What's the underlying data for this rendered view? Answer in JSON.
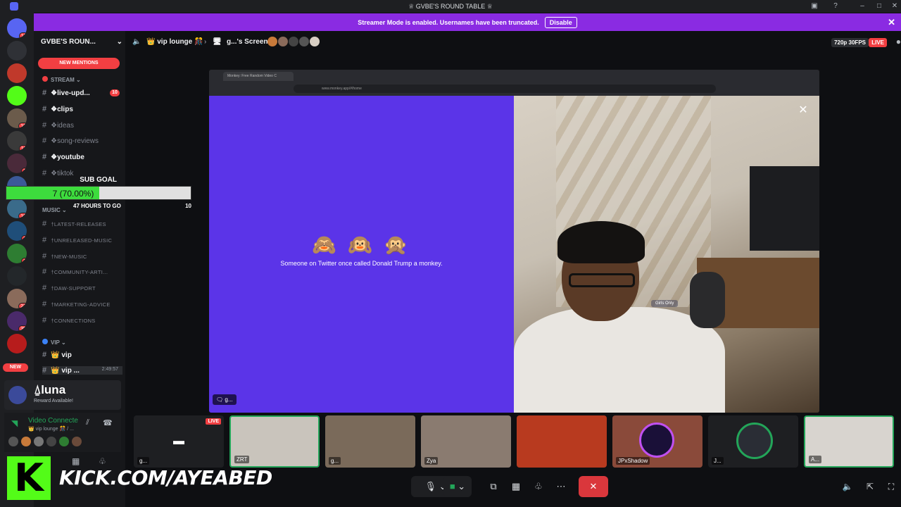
{
  "window": {
    "title": "♕ GVBE'S ROUND TABLE ♕",
    "minimize": "–",
    "maximize": "□",
    "close": "✕"
  },
  "streamer_banner": {
    "message": "Streamer Mode is enabled. Usernames have been truncated.",
    "button": "Disable",
    "close": "✕"
  },
  "server_rail": {
    "items": [
      {
        "icon": "discord-home-icon",
        "badge": "11",
        "color": "#5865f2"
      },
      {
        "icon": "server-icon",
        "badge": "",
        "color": "#2f3136"
      },
      {
        "icon": "server-icon",
        "badge": "",
        "color": "#c0392b"
      },
      {
        "icon": "kick-server-icon",
        "badge": "",
        "color": "#53fc18"
      },
      {
        "icon": "server-icon",
        "badge": "10",
        "color": "#6b5b4b"
      },
      {
        "icon": "server-icon",
        "badge": "11",
        "color": "#3a3a3a"
      },
      {
        "icon": "server-icon",
        "badge": "1",
        "color": "#4a2a3a"
      },
      {
        "icon": "server-icon",
        "badge": "",
        "color": "#3b5998"
      },
      {
        "icon": "server-icon",
        "badge": "10",
        "color": "#3a6b8a"
      },
      {
        "icon": "server-icon",
        "badge": "1",
        "color": "#1f4e79"
      },
      {
        "icon": "server-icon",
        "badge": "1",
        "color": "#2e7d32"
      },
      {
        "icon": "server-icon",
        "badge": "",
        "color": "#23272a"
      },
      {
        "icon": "server-icon",
        "badge": "27",
        "color": "#8a6b5b"
      },
      {
        "icon": "server-icon",
        "badge": "35",
        "color": "#4a2a6a"
      },
      {
        "icon": "server-icon",
        "badge": "",
        "color": "#b71c1c"
      }
    ],
    "new_label": "NEW"
  },
  "channels": {
    "server_name": "GVBE'S ROUN...",
    "new_mentions": "NEW MENTIONS",
    "stream_category": "STREAM",
    "stream_items": [
      {
        "name": "❖live-upd...",
        "badge": "10",
        "unread": true
      },
      {
        "name": "❖clips",
        "badge": "",
        "unread": true
      },
      {
        "name": "❖ideas",
        "badge": "",
        "unread": false
      },
      {
        "name": "❖song-reviews",
        "badge": "",
        "unread": false
      },
      {
        "name": "❖youtube",
        "badge": "",
        "unread": true
      },
      {
        "name": "❖tiktok",
        "badge": "",
        "unread": false
      }
    ],
    "music_category": "MUSIC",
    "music_items": [
      "†LATEST-RELEASES",
      "†UNRELEASED-MUSIC",
      "†NEW-MUSIC",
      "†COMMUNITY-ARTI...",
      "†DAW-SUPPORT",
      "†MARKETING-ADVICE",
      "†CONNECTIONS"
    ],
    "vip_category": "VIP",
    "vip_items": [
      {
        "name": "👑 vip"
      },
      {
        "name": "👑 vip ...",
        "time": "2:49:57"
      }
    ]
  },
  "sub_goal": {
    "label": "SUB GOAL",
    "progress_text": "7 (70.00%)",
    "progress_fraction": 0.7,
    "time_left": "47 HOURS TO GO",
    "target": "10"
  },
  "luna": {
    "name": "luna",
    "subtitle": "Reward Available!"
  },
  "voice": {
    "status": "Video Connecte",
    "channel": "👑 vip lounge 🎊 / ..."
  },
  "kick_overlay": {
    "logo": "K",
    "url": "KICK.COM/AYEABED"
  },
  "topbar": {
    "channel": "👑 vip lounge 🎊",
    "screen": "g...'s Screen",
    "quality": "720p 30FPS",
    "live": "LIVE"
  },
  "screenshare": {
    "browser_tab": "Monkey: Free Random Video C",
    "address": "www.monkey.app/#/home",
    "emojis": "🙈 🙉 🙊",
    "message": "Someone on Twitter once called Donald Trump a monkey.",
    "overlay_text": "Girls Only",
    "label": "g..."
  },
  "tiles": [
    {
      "label": "g...",
      "live": "LIVE",
      "speaking": false,
      "bg": "#1e1f22"
    },
    {
      "label": "ZRT",
      "speaking": true,
      "bg": "#c9c4bc"
    },
    {
      "label": "g...",
      "speaking": false,
      "bg": "#7a6a5a"
    },
    {
      "label": "Zya",
      "speaking": false,
      "bg": "#8a7b70"
    },
    {
      "label": "",
      "speaking": false,
      "bg": "#b83a1f"
    },
    {
      "label": "JPxShadow",
      "speaking": false,
      "bg": "#8a4a3a"
    },
    {
      "label": "J...",
      "speaking": false,
      "bg": "#1e1f22"
    },
    {
      "label": "A...",
      "speaking": true,
      "bg": "#d8d4cf"
    }
  ],
  "colors": {
    "accent": "#5865f2",
    "streamer_banner": "#8a2be2",
    "monkey_bg": "#5b34e8",
    "end_call": "#da373c",
    "kick_green": "#53fc18",
    "goal_fill": "#3ddc3d"
  }
}
